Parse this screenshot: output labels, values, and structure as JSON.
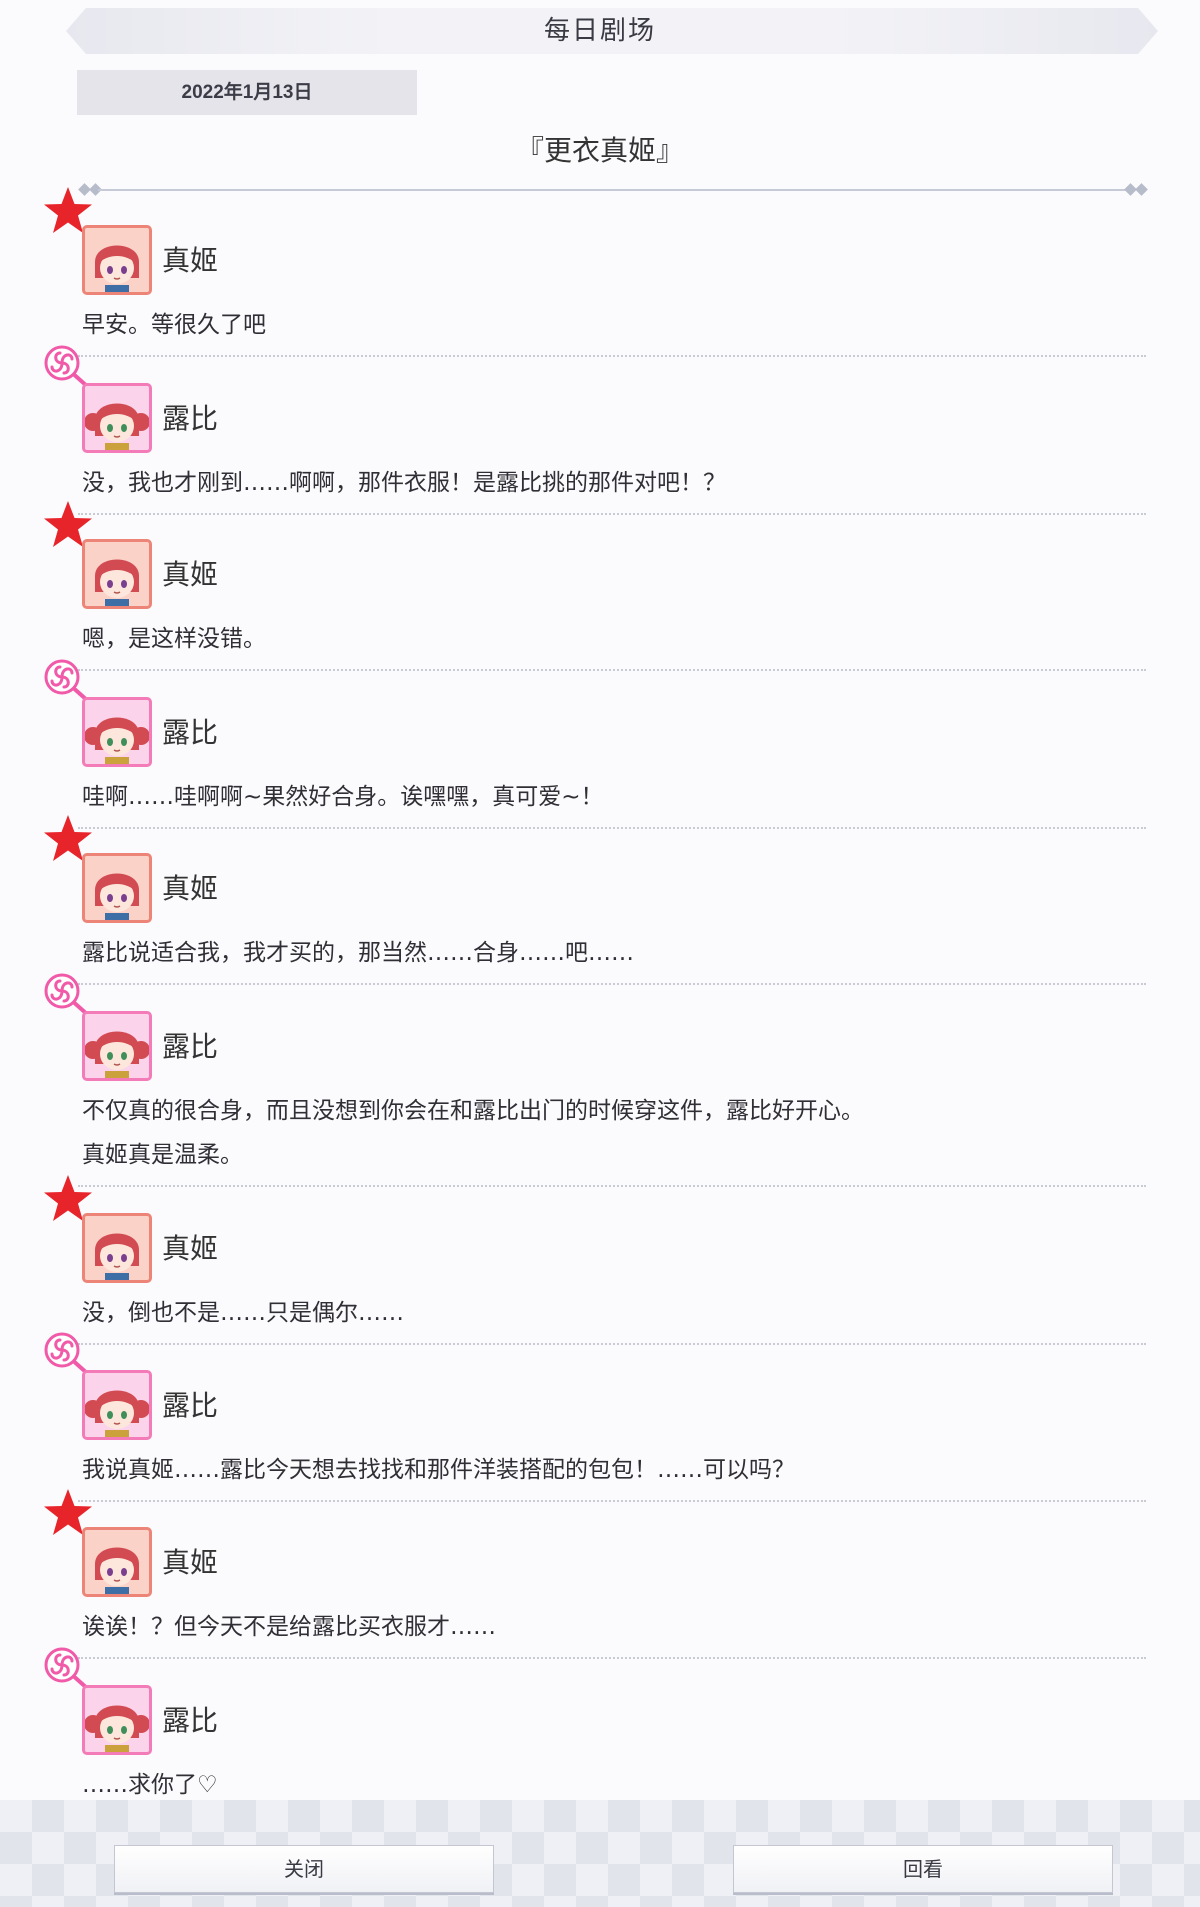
{
  "header": {
    "title": "每日剧场"
  },
  "story": {
    "date": "2022年1月13日",
    "title": "『更衣真姬』"
  },
  "characters": {
    "maki": {
      "name": "真姬",
      "mark_icon": "red-star-icon",
      "color": "#e8242b"
    },
    "ruby": {
      "name": "露比",
      "mark_icon": "pink-lollipop-icon",
      "color": "#f05aa8"
    }
  },
  "dialogue": [
    {
      "speaker": "真姬",
      "character": "maki",
      "lines": [
        "早安。等很久了吧"
      ]
    },
    {
      "speaker": "露比",
      "character": "ruby",
      "lines": [
        "没，我也才刚到……啊啊，那件衣服！是露比挑的那件对吧！？"
      ]
    },
    {
      "speaker": "真姬",
      "character": "maki",
      "lines": [
        "嗯，是这样没错。"
      ]
    },
    {
      "speaker": "露比",
      "character": "ruby",
      "lines": [
        "哇啊……哇啊啊~果然好合身。诶嘿嘿，真可爱~！"
      ]
    },
    {
      "speaker": "真姬",
      "character": "maki",
      "lines": [
        "露比说适合我，我才买的，那当然……合身……吧……"
      ]
    },
    {
      "speaker": "露比",
      "character": "ruby",
      "lines": [
        "不仅真的很合身，而且没想到你会在和露比出门的时候穿这件，露比好开心。",
        "真姬真是温柔。"
      ]
    },
    {
      "speaker": "真姬",
      "character": "maki",
      "lines": [
        "没，倒也不是……只是偶尔……"
      ]
    },
    {
      "speaker": "露比",
      "character": "ruby",
      "lines": [
        "我说真姬……露比今天想去找找和那件洋装搭配的包包！……可以吗？"
      ]
    },
    {
      "speaker": "真姬",
      "character": "maki",
      "lines": [
        "诶诶！？但今天不是给露比买衣服才……"
      ]
    },
    {
      "speaker": "露比",
      "character": "ruby",
      "lines": [
        "……求你了♡"
      ]
    }
  ],
  "buttons": {
    "close": "关闭",
    "replay": "回看"
  }
}
